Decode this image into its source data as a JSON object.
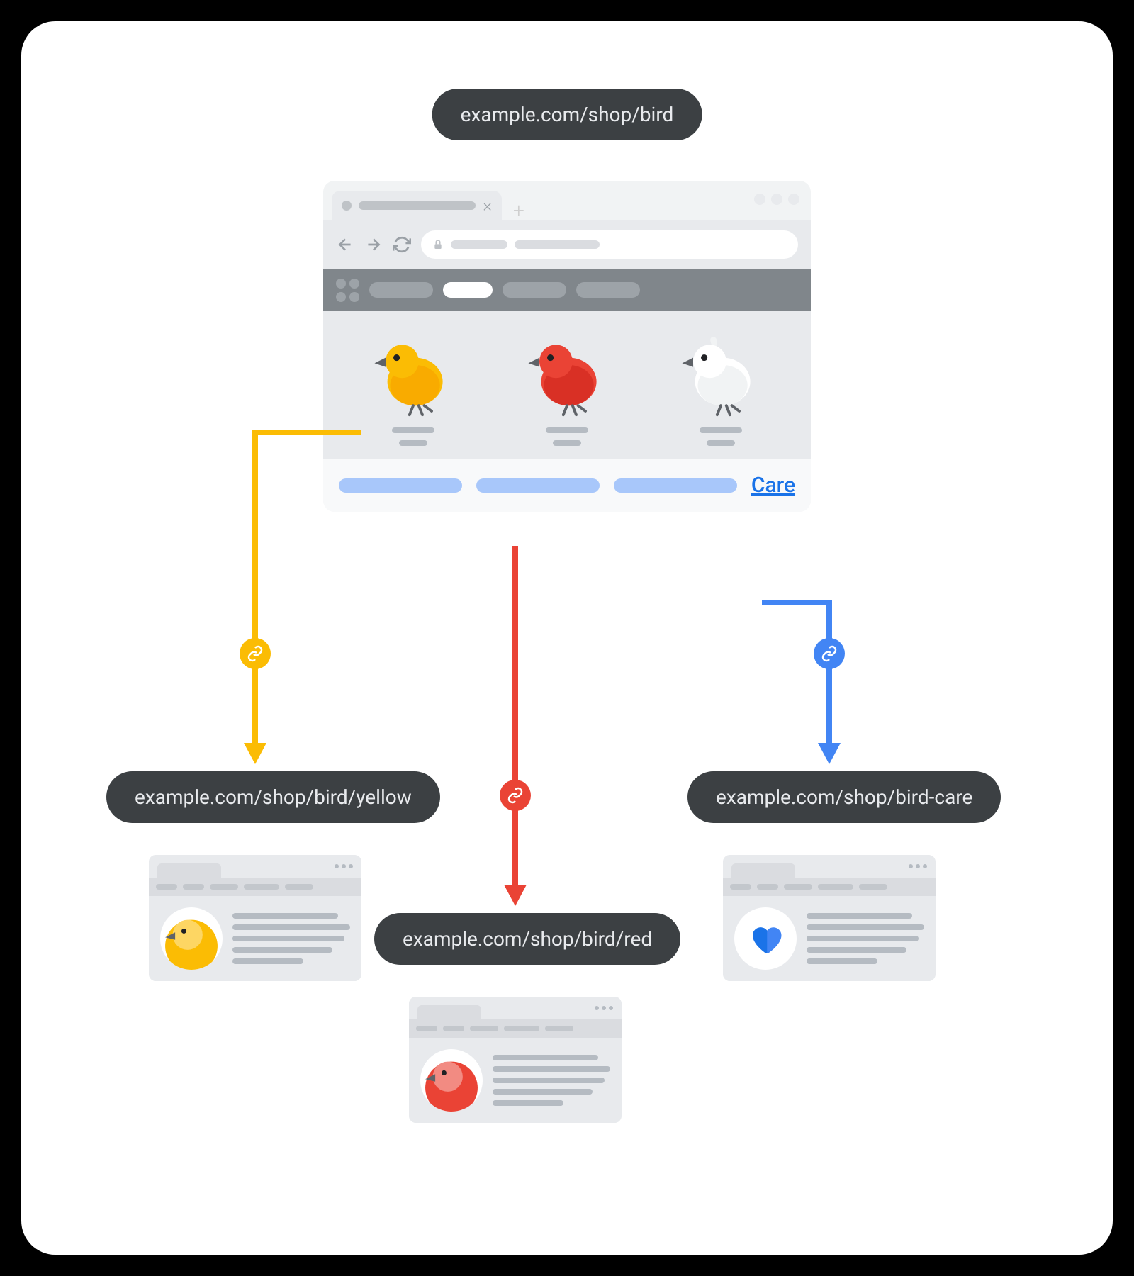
{
  "urls": {
    "main": "example.com/shop/bird",
    "yellow": "example.com/shop/bird/yellow",
    "red": "example.com/shop/bird/red",
    "care": "example.com/shop/bird-care"
  },
  "footer": {
    "care_label": "Care"
  },
  "colors": {
    "yellow": "#fbbc04",
    "red": "#ea4335",
    "blue": "#4285f4",
    "pill_bg": "#3c4043"
  }
}
